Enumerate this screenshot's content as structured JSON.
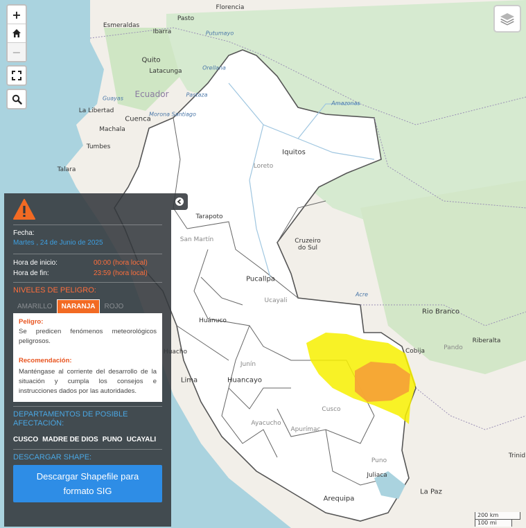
{
  "map": {
    "labels": {
      "florencia": "Florencia",
      "pasto": "Pasto",
      "esmeraldas": "Esmeraldas",
      "ibarra": "Ibarra",
      "putumayo": "Putumayo",
      "quito": "Quito",
      "latacunga": "Latacunga",
      "orellana": "Orellana",
      "ecuador": "Ecuador",
      "guayas": "Guayas",
      "la_libertad": "La Libertad",
      "pastaza": "Pastaza",
      "morona_santiago": "Morona Santiago",
      "cuenca": "Cuenca",
      "machala": "Machala",
      "tumbes": "Tumbes",
      "talara": "Talara",
      "iquitos": "Iquitos",
      "loreto": "Loreto",
      "amazonas_river": "Amazonas",
      "tarapoto": "Tarapoto",
      "san_martin": "San Martín",
      "pucallpa": "Pucallpa",
      "ucayali": "Ucayali",
      "huanuco": "Huánuco",
      "huacho": "Huacho",
      "lima": "Lima",
      "huancayo": "Huancayo",
      "junin": "Junín",
      "cruzeiro": "Cruzeiro\ndo Sul",
      "acre": "Acre",
      "rio_branco": "Rio Branco",
      "pando": "Pando",
      "riberalta": "Riberalta",
      "cobija": "Cobija",
      "cusco": "Cusco",
      "ayacucho": "Ayacucho",
      "apurimac": "Apurímac",
      "puno": "Puno",
      "juliaca": "Juliaca",
      "arequipa": "Arequipa",
      "la_paz": "La Paz",
      "trinidad": "Trinid"
    },
    "scale": {
      "metric": "200 km",
      "imperial": "100 mi"
    },
    "colors": {
      "yellow_zone": "#f7f000",
      "orange_zone": "#f5a336",
      "land": "#f2efe9",
      "forest": "#cfe8c2",
      "water": "#aad3df",
      "peru": "#ffffff"
    }
  },
  "controls": {
    "zoom_in": "+",
    "home_icon": "home-icon",
    "zoom_out": "−",
    "fullscreen_icon": "fullscreen-icon",
    "search_icon": "search-icon",
    "layers_icon": "layers-icon"
  },
  "panel": {
    "icon": "warning-icon",
    "fecha_label": "Fecha:",
    "fecha_value": "Martes , 24 de Junio de 2025",
    "inicio_label": "Hora de inicio:",
    "inicio_value": "00:00 (hora local)",
    "fin_label": "Hora de fin:",
    "fin_value": "23:59 (hora local)",
    "niveles_title": "NIVELES DE PELIGRO:",
    "tabs": [
      "AMARILLO",
      "NARANJA",
      "ROJO"
    ],
    "active_tab": "NARANJA",
    "peligro_label": "Peligro:",
    "peligro_text": "Se predicen fenómenos meteorológicos peligrosos.",
    "recomendacion_label": "Recomendación:",
    "recomendacion_text": "Manténgase al corriente del desarrollo de la situación y cumpla los consejos e instrucciones dados por las autoridades.",
    "departamentos_title": "DEPARTAMENTOS DE POSIBLE AFECTACIÓN:",
    "departamentos": [
      "CUSCO",
      "MADRE DE DIOS",
      "PUNO",
      "UCAYALI"
    ],
    "descargar_title": "DESCARGAR SHAPE:",
    "download_button": "Descargar Shapefile para formato SIG"
  }
}
